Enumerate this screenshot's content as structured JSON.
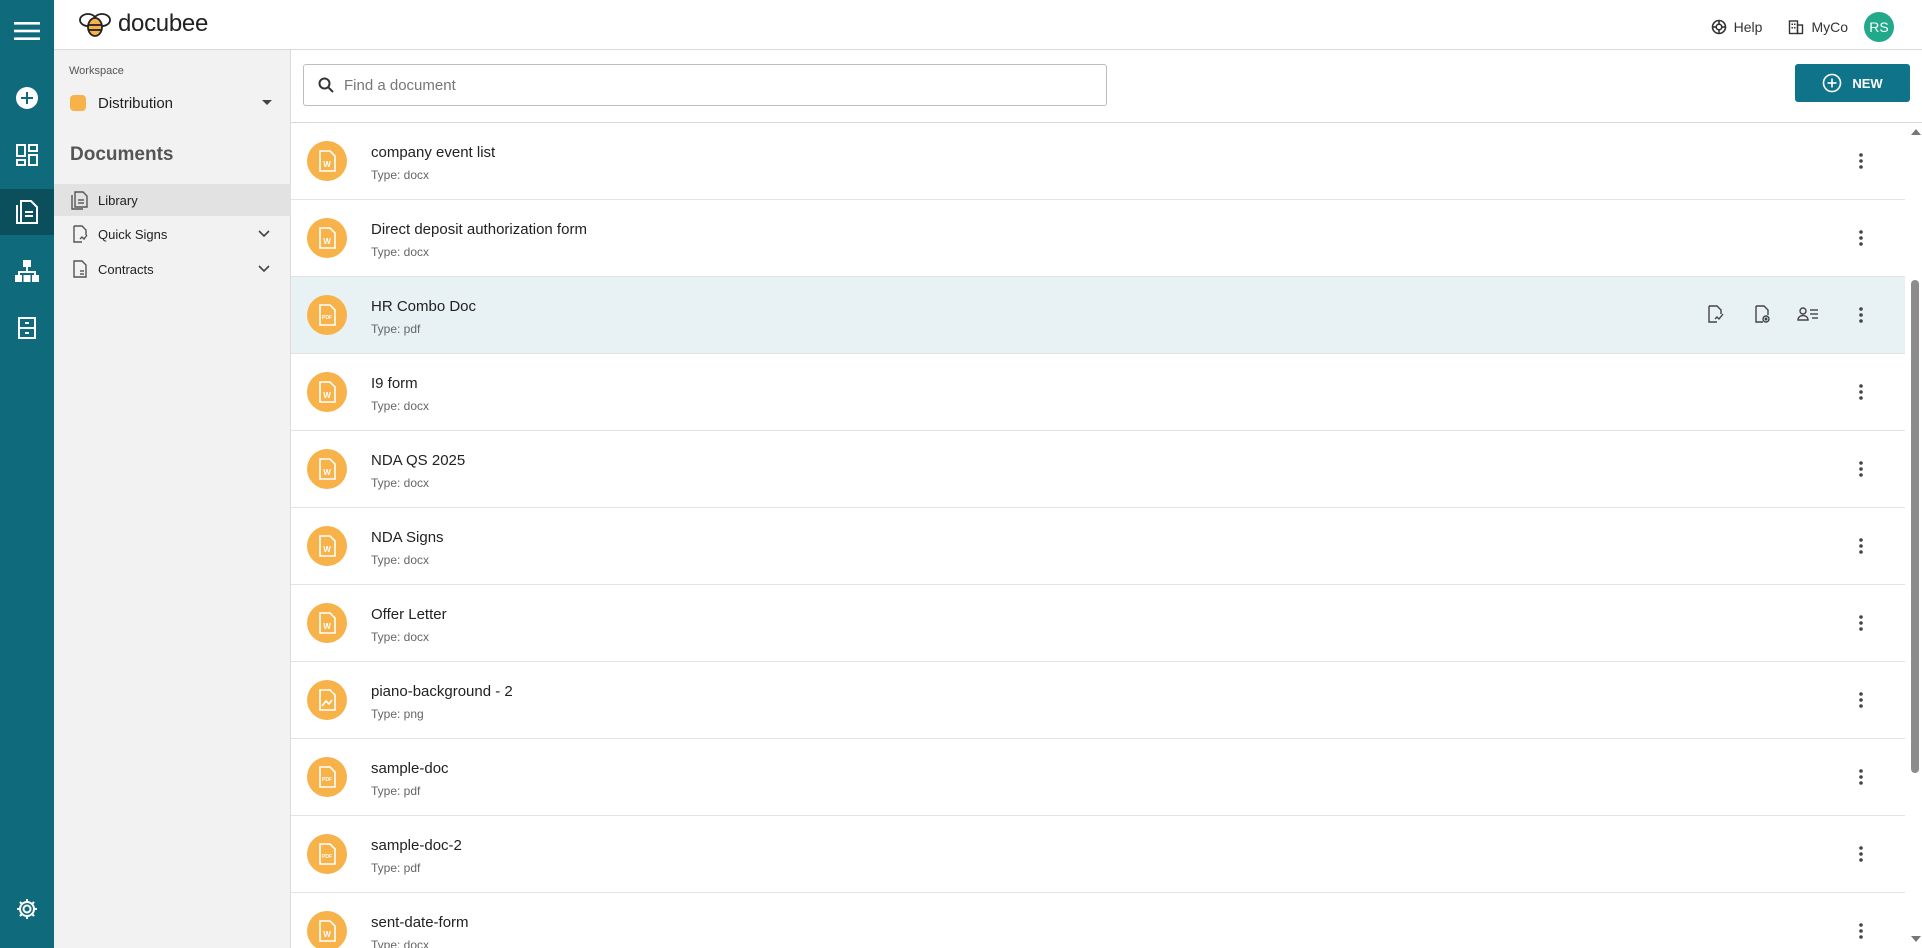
{
  "app": {
    "brand": "docubee",
    "colors": {
      "rail": "#0f6b7c",
      "accent": "#0f7489",
      "file_icon": "#f7b24a",
      "avatar": "#22a88b",
      "workspace_swatch": "#f7b24a"
    }
  },
  "rail": {
    "items": [
      {
        "name": "menu-icon"
      },
      {
        "name": "add-circle-icon"
      },
      {
        "name": "dashboard-icon"
      },
      {
        "name": "documents-icon",
        "active": true
      },
      {
        "name": "org-chart-icon"
      },
      {
        "name": "cabinet-icon"
      },
      {
        "name": "settings-gear-icon"
      }
    ]
  },
  "header": {
    "help_label": "Help",
    "org_label": "MyCo",
    "avatar_initials": "RS"
  },
  "sidebar": {
    "workspace_label": "Workspace",
    "workspace_name": "Distribution",
    "section_title": "Documents",
    "items": [
      {
        "label": "Library",
        "icon": "library-icon",
        "active": true,
        "expandable": false
      },
      {
        "label": "Quick Signs",
        "icon": "quick-sign-icon",
        "active": false,
        "expandable": true
      },
      {
        "label": "Contracts",
        "icon": "contract-icon",
        "active": false,
        "expandable": true
      }
    ]
  },
  "main": {
    "search_placeholder": "Find a document",
    "search_value": "",
    "new_button_label": "NEW",
    "documents": [
      {
        "name": "company event list",
        "type": "Type: docx",
        "icon": "word-file-icon"
      },
      {
        "name": "Direct deposit authorization form",
        "type": "Type: docx",
        "icon": "word-file-icon"
      },
      {
        "name": "HR Combo Doc",
        "type": "Type: pdf",
        "icon": "pdf-file-icon",
        "highlighted": true
      },
      {
        "name": "I9 form",
        "type": "Type: docx",
        "icon": "word-file-icon"
      },
      {
        "name": "NDA QS 2025",
        "type": "Type: docx",
        "icon": "word-file-icon"
      },
      {
        "name": "NDA Signs",
        "type": "Type: docx",
        "icon": "word-file-icon"
      },
      {
        "name": "Offer Letter",
        "type": "Type: docx",
        "icon": "word-file-icon"
      },
      {
        "name": "piano-background - 2",
        "type": "Type: png",
        "icon": "image-file-icon"
      },
      {
        "name": "sample-doc",
        "type": "Type: pdf",
        "icon": "pdf-file-icon"
      },
      {
        "name": "sample-doc-2",
        "type": "Type: pdf",
        "icon": "pdf-file-icon"
      },
      {
        "name": "sent-date-form",
        "type": "Type: docx",
        "icon": "word-file-icon"
      }
    ],
    "row_actions": [
      "sign-document-icon",
      "preview-document-icon",
      "assign-signers-icon"
    ]
  }
}
